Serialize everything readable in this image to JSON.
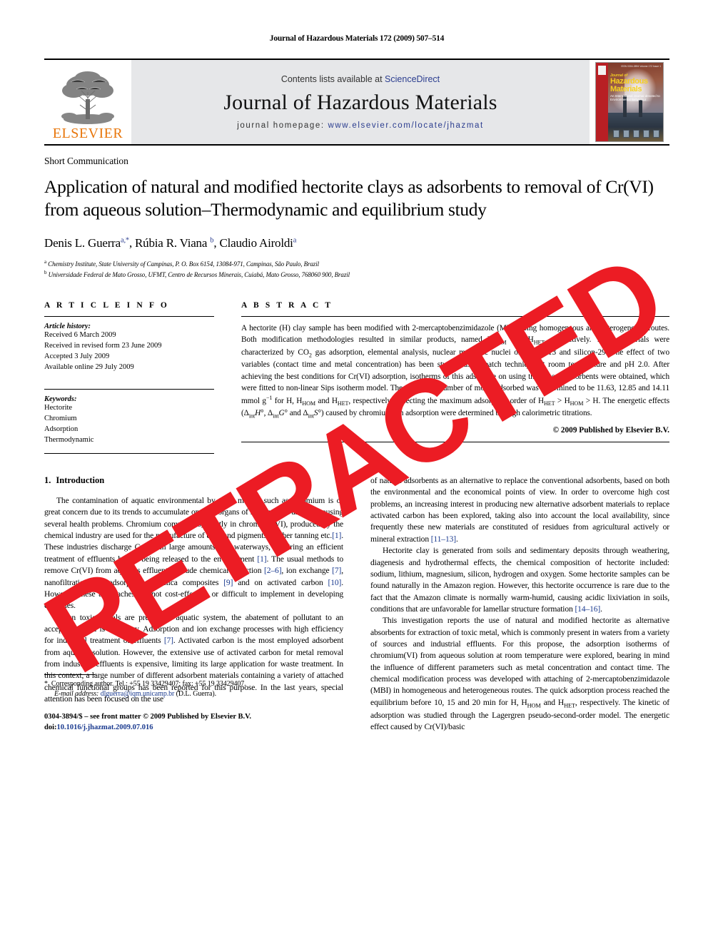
{
  "running_head": "Journal of Hazardous Materials 172 (2009) 507–514",
  "masthead": {
    "contents_prefix": "Contents lists available at ",
    "sciencedirect": "ScienceDirect",
    "journal_title": "Journal of Hazardous Materials",
    "homepage_label": "journal homepage: ",
    "homepage_url": "www.elsevier.com/locate/jhazmat",
    "publisher_wordmark": "ELSEVIER",
    "cover": {
      "line1": "Journal of",
      "line2": "Hazardous",
      "line3": "Materials",
      "subtitle": "An International Journal devoted to\nEnvironmental Behaviour",
      "corner_text": "ISSN 0304-3894\nVolume 172 Issue 1"
    }
  },
  "article": {
    "type": "Short Communication",
    "title": "Application of natural and modified hectorite clays as adsorbents to removal of Cr(VI) from aqueous solution–Thermodynamic and equilibrium study",
    "authors_plain": "Denis L. Guerra a,*, Rúbia R. Viana b, Claudio Airoldi a",
    "authors": [
      {
        "name": "Denis L. Guerra",
        "marks": "a,*"
      },
      {
        "name": "Rúbia R. Viana",
        "marks": "b"
      },
      {
        "name": "Claudio Airoldi",
        "marks": "a"
      }
    ],
    "affiliations": [
      {
        "mark": "a",
        "text": "Chemistry Institute, State University of Campinas, P. O. Box 6154, 13084-971, Campinas, São Paulo, Brazil"
      },
      {
        "mark": "b",
        "text": "Universidade Federal de Mato Grosso, UFMT, Centro de Recursos Minerais, Cuiabá, Mato Grosso, 768060 900, Brazil"
      }
    ]
  },
  "article_info": {
    "heading": "A R T I C L E    I N F O",
    "history_label": "Article history:",
    "history": [
      "Received 6 March 2009",
      "Received in revised form 23 June 2009",
      "Accepted 3 July 2009",
      "Available online 29 July 2009"
    ],
    "keywords_label": "Keywords:",
    "keywords": [
      "Hectorite",
      "Chromium",
      "Adsorption",
      "Thermodynamic"
    ]
  },
  "abstract": {
    "heading": "A B S T R A C T",
    "paragraphs": [
      "A hectorite (H) clay sample has been modified with 2-mercaptobenzimidazole (MBI) using homogeneous and heterogeneous routes. Both modification methodologies resulted in similar products, named H<sub>HOM</sub> and H<sub>HET</sub>, respectively. These materials were characterized by CO<sub>2</sub> gas adsorption, elemental analysis, nuclear magnetic nuclei of carbon-13 and silicon-29. The effect of two variables (contact time and metal concentration) has been studied using batch technique at room temperature and pH 2.0. After achieving the best conditions for Cr(VI) adsorption, isotherms of this adsorbate on using the chosen adsorbents were obtained, which were fitted to non-linear Sips isotherm model. The maximum number of moles adsorbed was determined to be 11.63, 12.85 and 14.11 mmol g<sup>−1</sup> for H, H<sub>HOM</sub> and H<sub>HET</sub>, respectively, reflecting the maximum adsorption order of H<sub>HET</sub> &gt; H<sub>HOM</sub> &gt; H. The energetic effects (Δ<sub>int</sub><i>H</i>°, Δ<sub>int</sub><i>G</i>° and Δ<sub>int</sub><i>S</i>°) caused by chromium ion adsorption were determined through calorimetric titrations."
    ],
    "copyright": "© 2009 Published by Elsevier B.V."
  },
  "body": {
    "section_number": "1.",
    "section_title": "Introduction",
    "left_paragraphs": [
      "The contamination of aquatic environmental by toxic metals, such as chromium is of great concern due to its trends to accumulate on vital organs of humans and animals causing several health problems. Chromium compounds, mostly in chromium(VI), produced by the chemical industry are used for the manufacture of dyes and pigments, leather tanning etc.<span class=\"ref\">[1]</span>. These industries discharge Cr(VI) in large amounts into waterways, requiring an efficient treatment of effluents before being released to the environment <span class=\"ref\">[1]</span>. The usual methods to remove Cr(VI) from aqueous effluents include chemical reduction <span class=\"ref\">[2–6]</span>, ion exchange <span class=\"ref\">[7]</span>, nanofiltration <span class=\"ref\">[8]</span>, adsorption on silica composites <span class=\"ref\">[9]</span> and on activated carbon <span class=\"ref\">[10]</span>. However, these approaches are not cost-effective or difficult to implement in developing countries.",
      "When toxic metals are present in aquatic system, the abatement of pollutant to an acceptable level is necessary. Adsorption and ion exchange processes with high efficiency for industrial treatment of effluents <span class=\"ref\">[7]</span>. Activated carbon is the most employed adsorbent from aqueous solution. However, the extensive use of activated carbon for metal removal from industrial effluents is expensive, limiting its large application for waste treatment. In this context, a large number of different adsorbent materials containing a variety of attached chemical functional groups has been reported for this purpose. In the last years, special attention has been focused on the use"
    ],
    "right_paragraphs": [
      "of natural adsorbents as an alternative to replace the conventional adsorbents, based on both the environmental and the economical points of view. In order to overcome high cost problems, an increasing interest in producing new alternative adsorbent materials to replace activated carbon has been explored, taking also into account the local availability, since frequently these new materials are constituted of residues from agricultural actively or mineral extraction <span class=\"ref\">[11–13]</span>.",
      "Hectorite clay is generated from soils and sedimentary deposits through weathering, diagenesis and hydrothermal effects, the chemical composition of hectorite included: sodium, lithium, magnesium, silicon, hydrogen and oxygen. Some hectorite samples can be found naturally in the Amazon region. However, this hectorite occurrence is rare due to the fact that the Amazon climate is normally warm-humid, causing acidic lixiviation in soils, conditions that are unfavorable for lamellar structure formation <span class=\"ref\">[14–16]</span>.",
      "This investigation reports the use of natural and modified hectorite as alternative absorbents for extraction of toxic metal, which is commonly present in waters from a variety of sources and industrial effluents. For this propose, the adsorption isotherms of chromium(VI) from aqueous solution at room temperature were explored, bearing in mind the influence of different parameters such as metal concentration and contact time. The chemical modification process was developed with attaching of 2-mercaptobenzimidazole (MBI) in homogeneous and heterogeneous routes. The quick adsorption process reached the equilibrium before 10, 15 and 20 min for H, H<sub>HOM</sub> and H<sub>HET</sub>, respectively. The kinetic of adsorption was studied through the Lagergren pseudo-second-order model. The energetic effect caused by Cr(VI)/basic"
    ]
  },
  "footnote": {
    "star": "*",
    "corresponding": "Corresponding author. Tel.: +55 19 33429407; fax: +55 19 33429407.",
    "email_label": "E-mail address:",
    "email": "dlguerra@iqm.unicamp.br",
    "email_owner": "(D.L. Guerra).",
    "issn_line": "0304-3894/$ – see front matter © 2009 Published by Elsevier B.V.",
    "doi_label": "doi:",
    "doi": "10.1016/j.jhazmat.2009.07.016"
  },
  "watermark": {
    "text": "RETRACTED",
    "color": "#ec1c24"
  }
}
